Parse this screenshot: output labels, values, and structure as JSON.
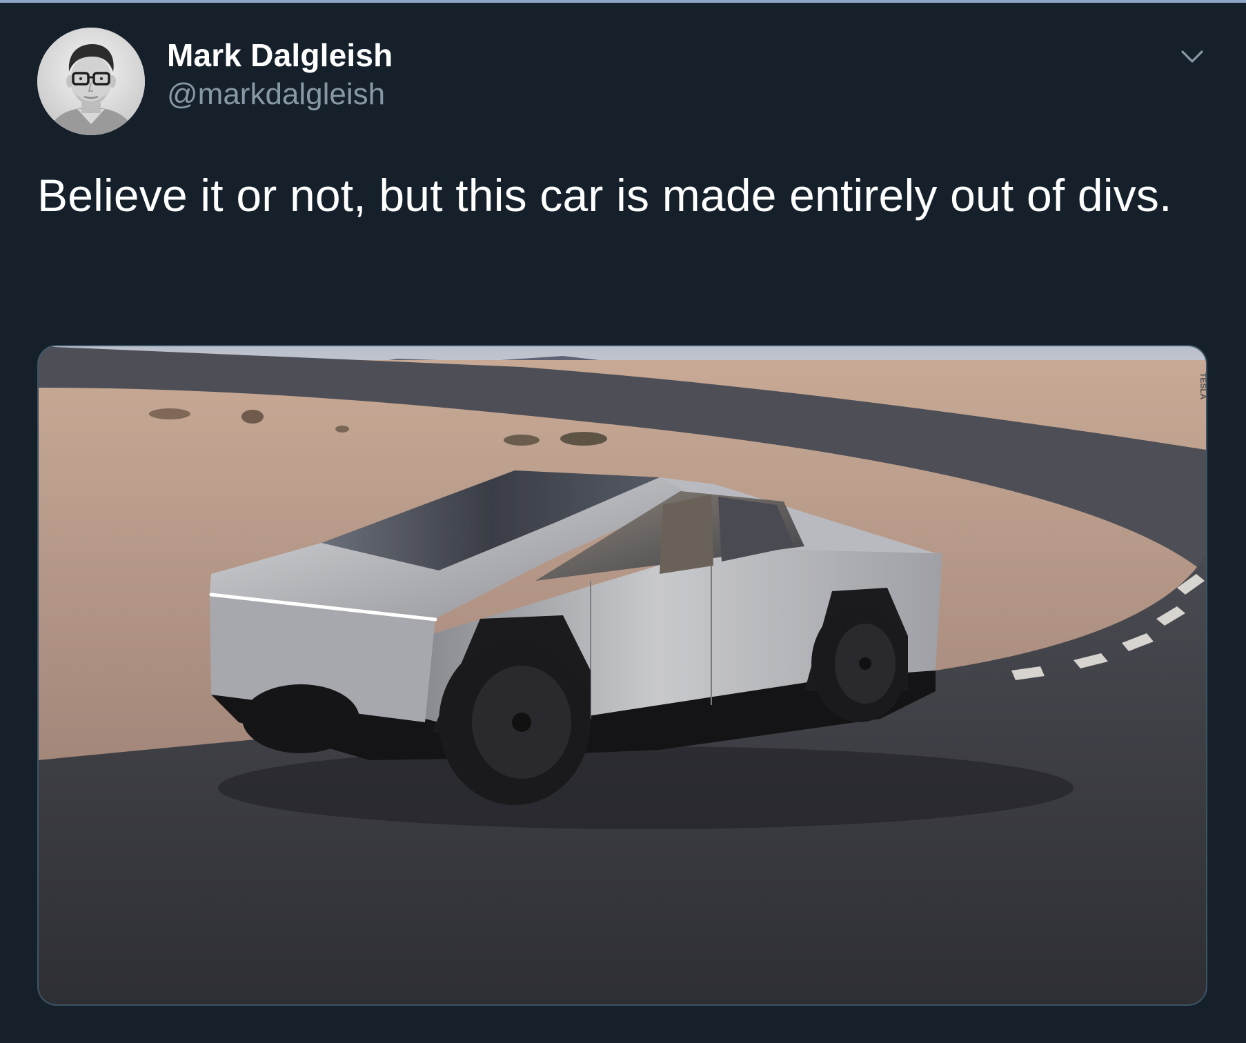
{
  "tweet": {
    "author": {
      "display_name": "Mark Dalgleish",
      "handle": "@markdalgleish",
      "avatar_icon": "user-avatar-photo"
    },
    "menu_icon": "chevron-down-icon",
    "text": "Believe it or not, but this car is made entirely out of divs.",
    "media": {
      "kind": "photo",
      "subject": "silver angular electric pickup truck on a desert track",
      "watermark_text": "TESLA"
    }
  },
  "colors": {
    "background": "#15202b",
    "top_rule": "#8fa6c8",
    "name_text": "#ffffff",
    "handle_text": "#8899a6",
    "media_border": "#3d5466"
  }
}
